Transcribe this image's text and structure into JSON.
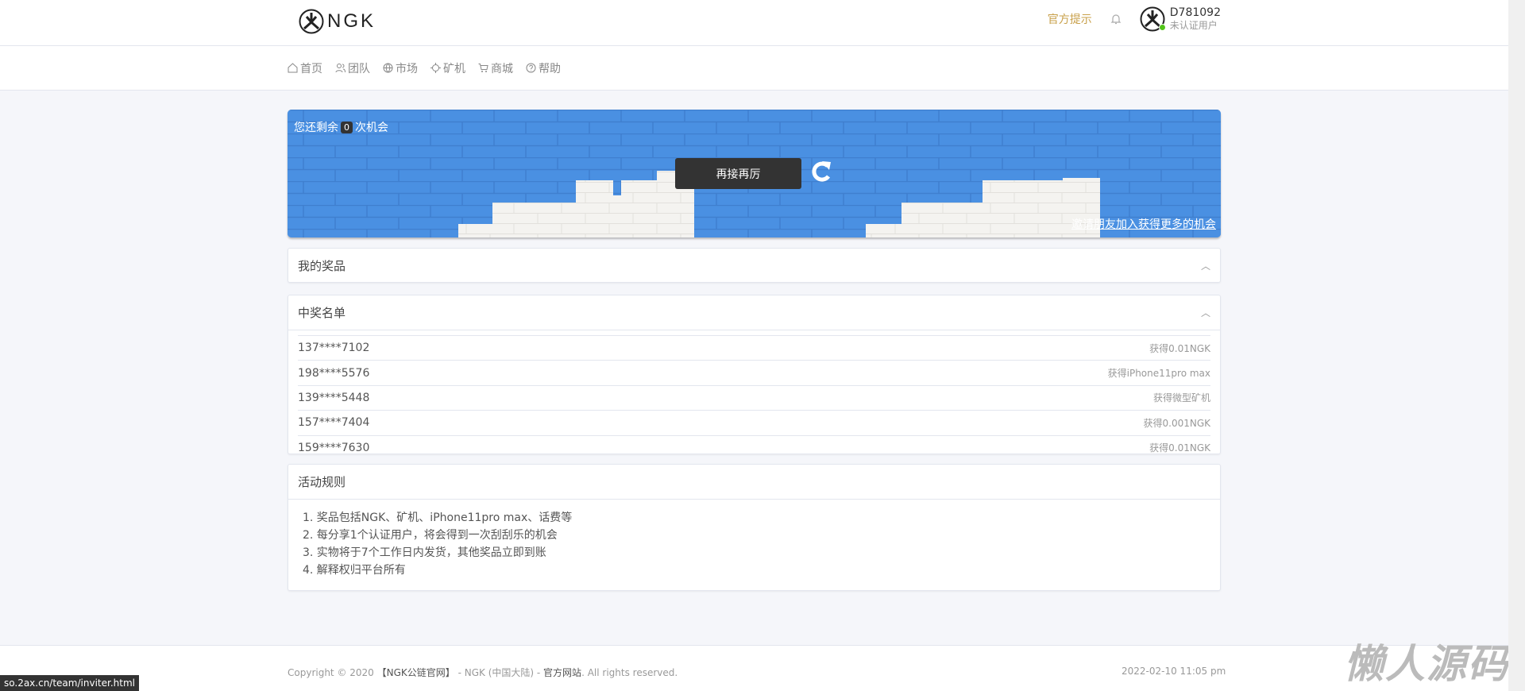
{
  "header": {
    "logo_text": "NGK",
    "notice": "官方提示",
    "username": "D781092",
    "user_status": "未认证用户"
  },
  "nav": [
    {
      "label": "首页",
      "icon": "home-icon"
    },
    {
      "label": "团队",
      "icon": "users-icon"
    },
    {
      "label": "市场",
      "icon": "globe-icon"
    },
    {
      "label": "矿机",
      "icon": "chip-icon"
    },
    {
      "label": "商城",
      "icon": "cart-icon"
    },
    {
      "label": "帮助",
      "icon": "help-icon"
    }
  ],
  "banner": {
    "remain_prefix": "您还剩余",
    "remain_count": "0",
    "remain_suffix": "次机会",
    "again_label": "再接再厉",
    "invite_link": "邀请朋友加入获得更多的机会",
    "color": "#4a90e2"
  },
  "prizes": {
    "title": "我的奖品"
  },
  "winners": {
    "title": "中奖名单",
    "rows": [
      {
        "user": "137****7102",
        "prize": "获得0.01NGK"
      },
      {
        "user": "198****5576",
        "prize": "获得iPhone11pro max"
      },
      {
        "user": "139****5448",
        "prize": "获得微型矿机"
      },
      {
        "user": "157****7404",
        "prize": "获得0.001NGK"
      },
      {
        "user": "159****7630",
        "prize": "获得0.01NGK"
      }
    ]
  },
  "rules": {
    "title": "活动规则",
    "items": [
      "1. 奖品包括NGK、矿机、iPhone11pro max、话费等",
      "2. 每分享1个认证用户，将会得到一次刮刮乐的机会",
      "3. 实物将于7个工作日内发货，其他奖品立即到账",
      "4. 解释权归平台所有"
    ]
  },
  "footer": {
    "copy_prefix": "Copyright © 2020",
    "brand": "【NGK公链官网】",
    "middle": " - NGK (中国大陆) - ",
    "site": "官方网站",
    "suffix": ". All rights reserved.",
    "date": "2022-02-10 11:05 pm"
  },
  "status_url": "so.2ax.cn/team/inviter.html",
  "watermark": "懒人源码"
}
